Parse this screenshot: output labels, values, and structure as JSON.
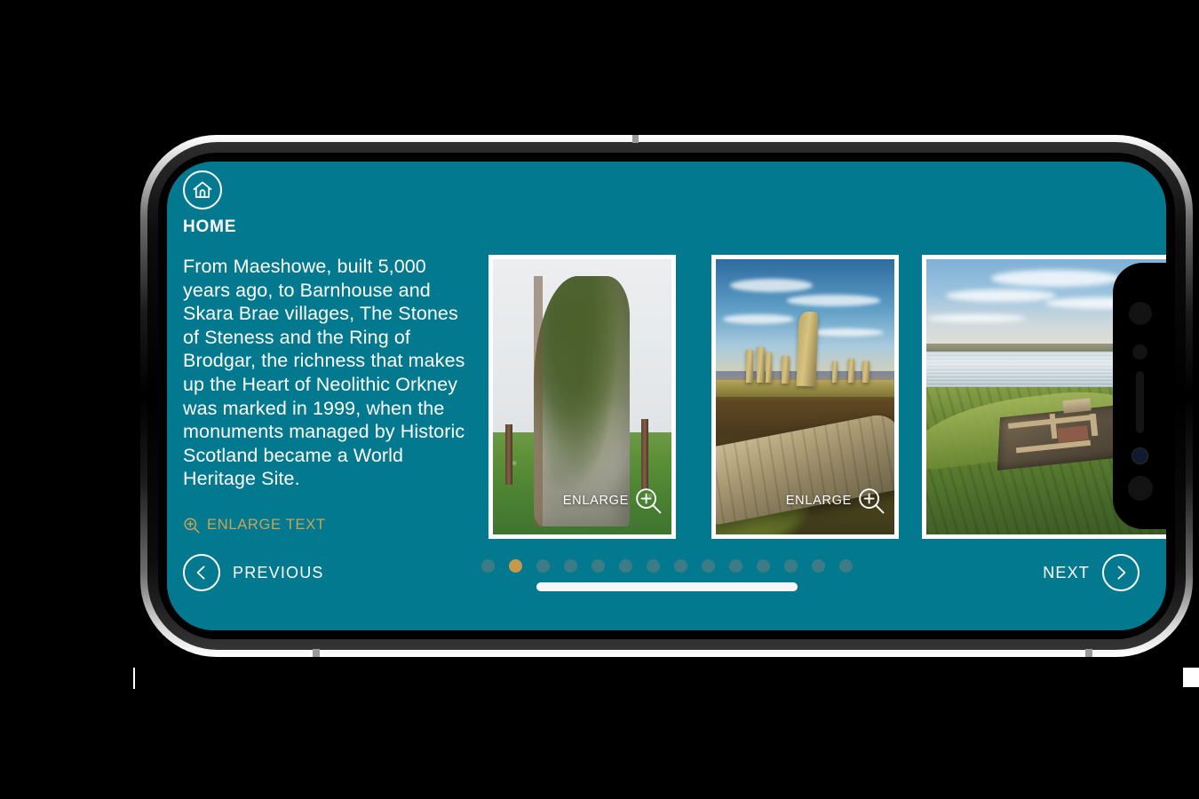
{
  "app": {
    "theme_color": "#03798F",
    "accent_gold": "#C89A48",
    "dot_inactive": "#3E7C85"
  },
  "header": {
    "home_label": "HOME",
    "home_icon": "home-icon"
  },
  "main": {
    "body_text": "From Maeshowe, built 5,000 years ago, to Barnhouse and Skara Brae villages, The Stones of Steness and the Ring of Brodgar, the richness that makes up the Heart of Neolithic Orkney was marked in 1999, when the monuments managed by Historic Scotland became a World Heritage Site.",
    "enlarge_text_label": "ENLARGE TEXT",
    "enlarge_text_icon": "magnifier-plus-icon"
  },
  "gallery": {
    "enlarge_icon": "magnifier-plus-icon",
    "cards": [
      {
        "id": "card-standing-stone",
        "enlarge_label": "ENLARGE",
        "alt": "Tall lichen-covered standing stone in a green field under overcast sky"
      },
      {
        "id": "card-ring-of-brodgar",
        "enlarge_label": "ENLARGE",
        "alt": "Ring of Brodgar standing stones on heather moorland with a fallen flagstone slab"
      },
      {
        "id": "card-barnhouse-village",
        "enlarge_label": "",
        "alt": "Aerial view of Barnhouse village excavation on a grassy shore beside the loch"
      }
    ]
  },
  "nav": {
    "previous_label": "PREVIOUS",
    "next_label": "NEXT",
    "previous_icon": "chevron-left-icon",
    "next_icon": "chevron-right-icon",
    "total_dots": 14,
    "active_dot_index": 2,
    "scroll_progress_percent": 100
  }
}
